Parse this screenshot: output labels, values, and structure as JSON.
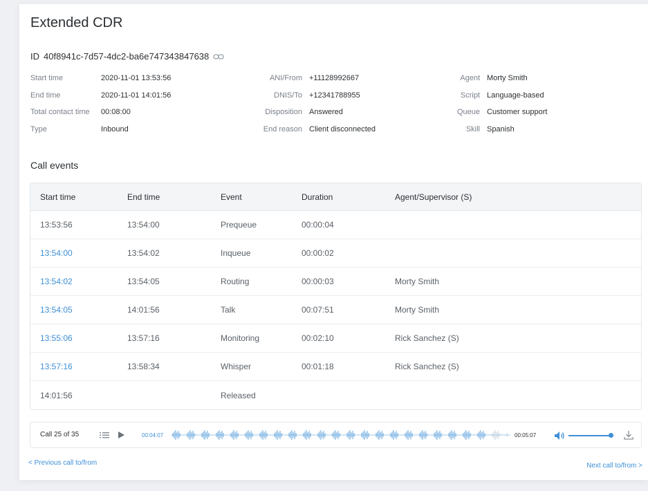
{
  "page": {
    "title": "Extended CDR",
    "id_prefix": "ID",
    "id_value": "40f8941c-7d57-4dc2-ba6e747343847638"
  },
  "info": {
    "col1": [
      {
        "label": "Start time",
        "value": "2020-11-01 13:53:56"
      },
      {
        "label": "End time",
        "value": "2020-11-01 14:01:56"
      },
      {
        "label": "Total contact time",
        "value": "00:08:00"
      },
      {
        "label": "Type",
        "value": "Inbound"
      }
    ],
    "col2": [
      {
        "label": "ANI/From",
        "value": "+11128992667"
      },
      {
        "label": "DNIS/To",
        "value": "+12341788955"
      },
      {
        "label": "Disposition",
        "value": "Answered"
      },
      {
        "label": "End reason",
        "value": "Client disconnected"
      }
    ],
    "col3": [
      {
        "label": "Agent",
        "value": "Morty Smith"
      },
      {
        "label": "Script",
        "value": "Language-based"
      },
      {
        "label": "Queue",
        "value": "Customer support"
      },
      {
        "label": "Skill",
        "value": "Spanish"
      }
    ]
  },
  "call_events": {
    "section_title": "Call events",
    "headers": [
      "Start time",
      "End time",
      "Event",
      "Duration",
      "Agent/Supervisor (S)"
    ],
    "rows": [
      {
        "start": "13:53:56",
        "end": "13:54:00",
        "event": "Prequeue",
        "duration": "00:00:04",
        "agent": ""
      },
      {
        "start": "13:54:00",
        "end": "13:54:02",
        "event": "Inqueue",
        "duration": "00:00:02",
        "agent": ""
      },
      {
        "start": "13:54:02",
        "end": "13:54:05",
        "event": "Routing",
        "duration": "00:00:03",
        "agent": "Morty Smith"
      },
      {
        "start": "13:54:05",
        "end": "14:01:56",
        "event": "Talk",
        "duration": "00:07:51",
        "agent": "Morty Smith"
      },
      {
        "start": "13:55:06",
        "end": "13:57:16",
        "event": "Monitoring",
        "duration": "00:02:10",
        "agent": "Rick Sanchez (S)"
      },
      {
        "start": "13:57:16",
        "end": "13:58:34",
        "event": "Whisper",
        "duration": "00:01:18",
        "agent": "Rick Sanchez (S)"
      },
      {
        "start": "14:01:56",
        "end": "",
        "event": "Released",
        "duration": "",
        "agent": ""
      }
    ]
  },
  "player": {
    "call_count": "Call 25 of 35",
    "current_time": "00:04:07",
    "total_time": "00:05:07",
    "volume": 0.95
  },
  "nav": {
    "prev": "< Previous call to/from",
    "next": "Next call to/from >"
  },
  "colors": {
    "accent": "#3d8fd6",
    "text": "#2b2f33",
    "muted": "#7a8088"
  },
  "icons": {
    "copy_link": "link-icon",
    "list": "list-icon",
    "play": "play-icon",
    "volume": "volume-icon",
    "download": "download-icon"
  }
}
